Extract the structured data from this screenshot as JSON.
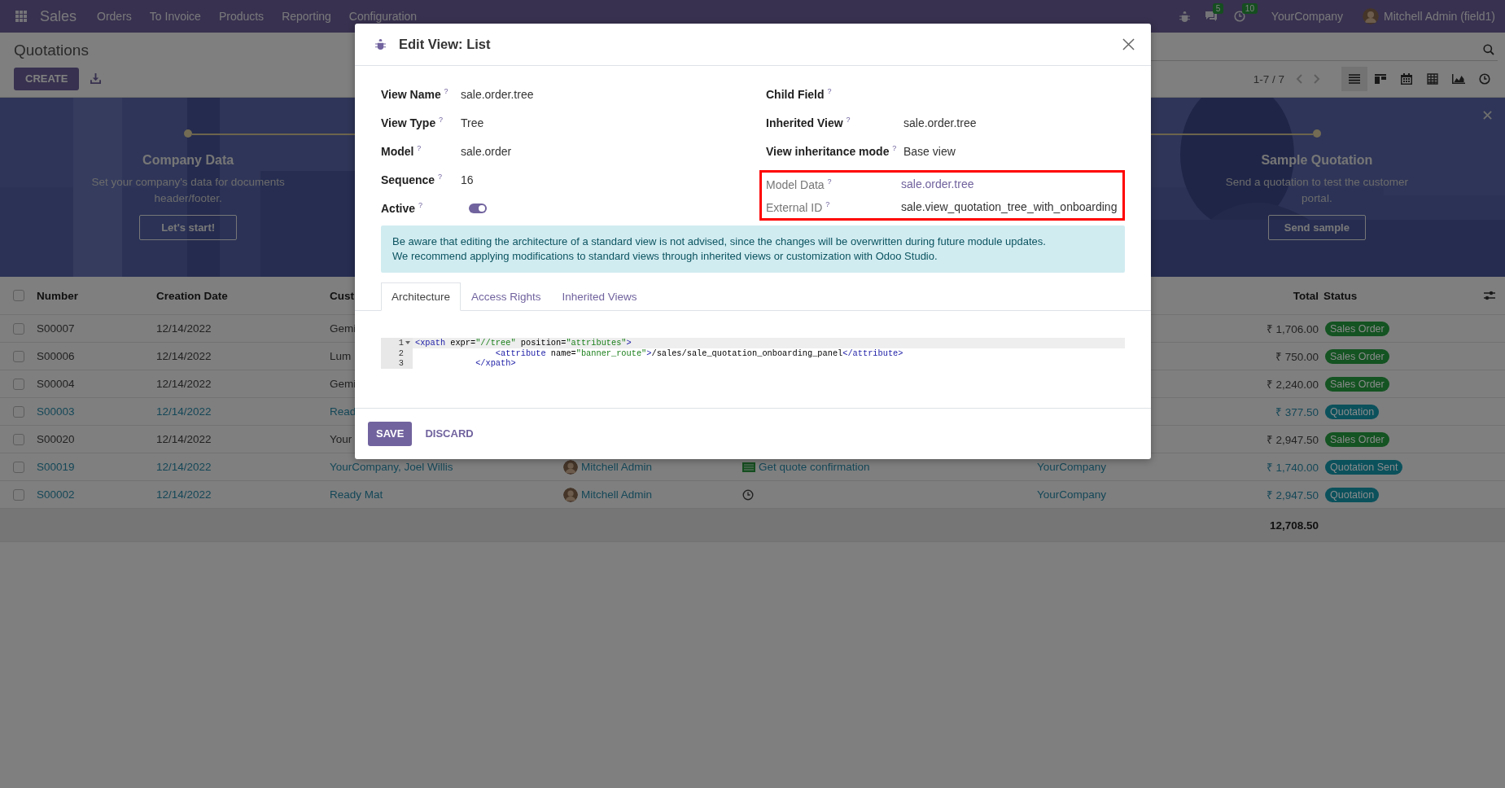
{
  "navbar": {
    "app": "Sales",
    "menu": [
      "Orders",
      "To Invoice",
      "Products",
      "Reporting",
      "Configuration"
    ],
    "chat_count": "5",
    "activity_count": "10",
    "company": "YourCompany",
    "user": "Mitchell Admin (field1)"
  },
  "control_panel": {
    "title": "Quotations",
    "create_button": "CREATE",
    "pager": "1-7 / 7",
    "views": [
      {
        "kind": "list",
        "selected": true
      },
      {
        "kind": "kanban",
        "selected": false
      },
      {
        "kind": "calendar",
        "selected": false
      },
      {
        "kind": "pivot",
        "selected": false
      },
      {
        "kind": "graph",
        "selected": false
      },
      {
        "kind": "activity",
        "selected": false
      }
    ]
  },
  "banner": {
    "steps": [
      {
        "title": "Company Data",
        "description": "Set your company's data for documents header/footer.",
        "button": "Let's start!"
      },
      {
        "title": "Sample Quotation",
        "description": "Send a quotation to test the customer portal.",
        "button": "Send sample"
      }
    ]
  },
  "table": {
    "header_checkbox": {
      "checked": false
    },
    "columns": [
      {
        "kind": "number",
        "label": "Number"
      },
      {
        "kind": "date",
        "label": "Creation Date"
      },
      {
        "kind": "customer",
        "label": "Cust"
      },
      {
        "kind": "total",
        "label": "Total"
      },
      {
        "kind": "status",
        "label": "Status"
      }
    ],
    "rows": [
      {
        "selected": false,
        "highlighted": false,
        "number": "S00007",
        "date": "12/14/2022",
        "customer": "Gemi",
        "total": "₹ 1,706.00",
        "status": {
          "label": "Sales Order",
          "color": "#145322"
        }
      },
      {
        "selected": false,
        "highlighted": false,
        "number": "S00006",
        "date": "12/14/2022",
        "customer": "Lum",
        "total": "₹ 750.00",
        "status": {
          "label": "Sales Order",
          "color": "#145322"
        }
      },
      {
        "selected": false,
        "highlighted": false,
        "number": "S00004",
        "date": "12/14/2022",
        "customer": "Gemi",
        "total": "₹ 2,240.00",
        "status": {
          "label": "Sales Order",
          "color": "#145322"
        }
      },
      {
        "selected": false,
        "highlighted": true,
        "number": "S00003",
        "date": "12/14/2022",
        "customer": "Read",
        "total": "₹ 377.50",
        "status": {
          "label": "Quotation",
          "color": "#0b515c"
        }
      },
      {
        "selected": false,
        "highlighted": false,
        "number": "S00020",
        "date": "12/14/2022",
        "customer": "Your",
        "total": "₹ 2,947.50",
        "status": {
          "label": "Sales Order",
          "color": "#145322"
        }
      },
      {
        "selected": false,
        "highlighted": true,
        "number": "S00019",
        "date": "12/14/2022",
        "customer": "YourCompany, Joel Willis",
        "salesperson": "Mitchell Admin",
        "activity": {
          "kind": "todo",
          "label": "Get quote confirmation"
        },
        "company": "YourCompany",
        "total": "₹ 1,740.00",
        "status": {
          "label": "Quotation Sent",
          "color": "#0b515c"
        }
      },
      {
        "selected": false,
        "highlighted": true,
        "number": "S00002",
        "date": "12/14/2022",
        "customer": "Ready Mat",
        "salesperson": "Mitchell Admin",
        "activity": {
          "kind": "clock"
        },
        "company": "YourCompany",
        "total": "₹ 2,947.50",
        "status": {
          "label": "Quotation",
          "color": "#0b515c"
        }
      }
    ],
    "grand_total": "12,708.50"
  },
  "dialog": {
    "title": "Edit View: List",
    "left_fields": [
      {
        "label": "View Name $^{?}$",
        "kind": "text",
        "value": "sale.order.tree"
      },
      {
        "label": "View Type $^{?}$",
        "kind": "text",
        "value": "Tree"
      },
      {
        "label": "Model $^{?}$",
        "kind": "text",
        "value": "sale.order"
      },
      {
        "label": "Sequence $^{?}$",
        "kind": "text",
        "value": "16"
      },
      {
        "label": "Active $^{?}$",
        "kind": "toggle",
        "on": true
      }
    ],
    "right_fields": [
      {
        "label": "Child Field $^{?}$",
        "kind": "empty"
      },
      {
        "label": "Inherited View $^{?}$",
        "kind": "text",
        "value": "sale.order.tree"
      },
      {
        "label": "View inheritance mode $^{?}$",
        "kind": "text",
        "value": "Base view"
      }
    ],
    "framed_fields": [
      {
        "label": "Model Data $^{?}$",
        "kind": "link",
        "value": "sale.order.tree",
        "readonly": true
      },
      {
        "label": "External ID $^{?}$",
        "kind": "text",
        "value": "sale.view_quotation_tree_with_onboarding",
        "readonly": true
      }
    ],
    "alert": [
      "Be aware that editing the architecture of a standard view is not advised, since the changes will be overwritten during future module updates.",
      "We recommend applying modifications to standard views through inherited views or customization with Odoo Studio."
    ],
    "tabs": [
      {
        "label": "Architecture",
        "selected": true
      },
      {
        "label": "Access Rights",
        "selected": false
      },
      {
        "label": "Inherited Views",
        "selected": false
      }
    ],
    "code": [
      {
        "number": "1",
        "foldable": true,
        "tokens": [
          {
            "kind": "tag",
            "text": "<xpath"
          },
          {
            "kind": "attr",
            "text": " expr="
          },
          {
            "kind": "string",
            "text": "\"//tree\""
          },
          {
            "kind": "attr",
            "text": " position="
          },
          {
            "kind": "string",
            "text": "\"attributes\""
          },
          {
            "kind": "tag",
            "text": ">"
          }
        ]
      },
      {
        "number": "2",
        "foldable": false,
        "tokens": [
          {
            "kind": "tag",
            "text": "                <attribute"
          },
          {
            "kind": "attr",
            "text": " name="
          },
          {
            "kind": "string",
            "text": "\"banner_route\""
          },
          {
            "kind": "tag",
            "text": ">"
          },
          {
            "kind": "text",
            "text": "/sales/sale_quotation_onboarding_panel"
          },
          {
            "kind": "tag",
            "text": "</attribute>"
          }
        ]
      },
      {
        "number": "3",
        "foldable": false,
        "tokens": [
          {
            "kind": "tag",
            "text": "            </xpath>"
          }
        ]
      }
    ],
    "save_button": "SAVE",
    "discard_button": "DISCARD"
  }
}
